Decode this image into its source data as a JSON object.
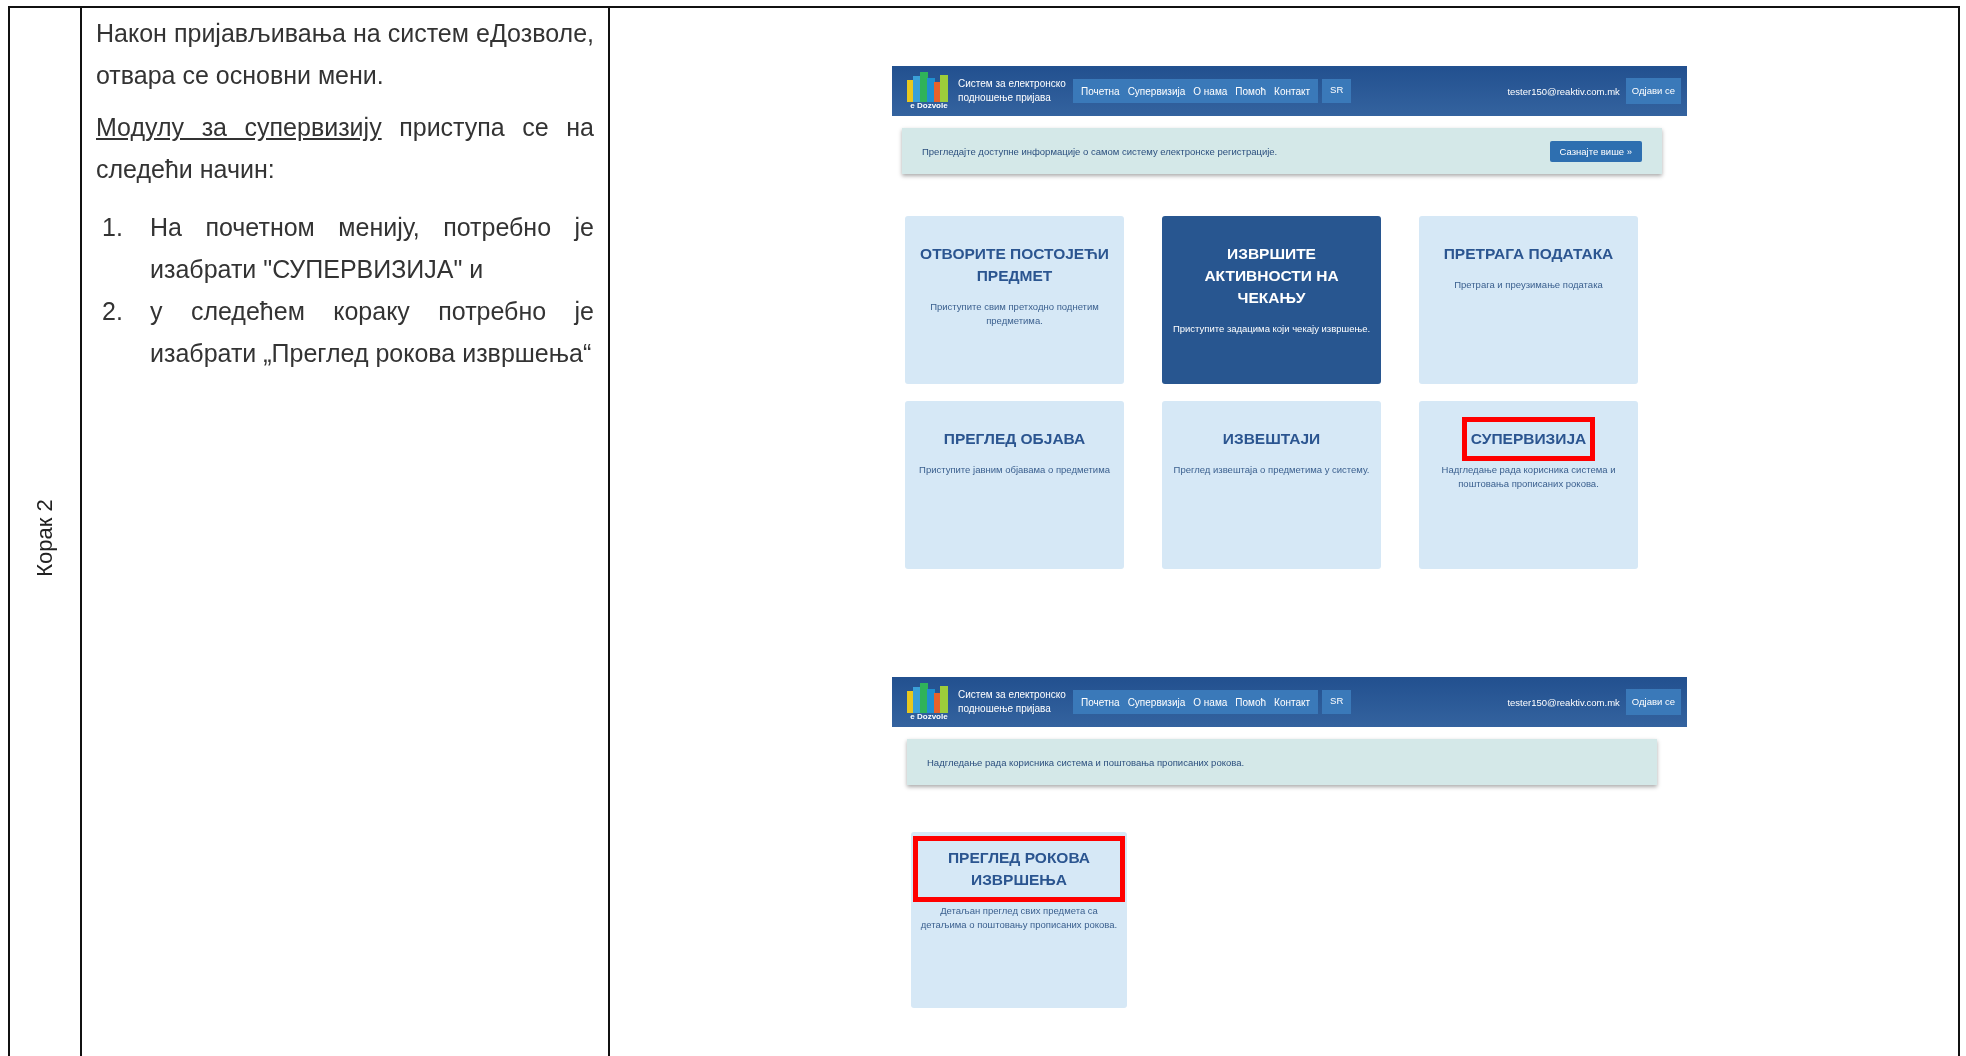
{
  "step_label": "Корак 2",
  "paragraphs": [
    {
      "text": "Након пријављивања на систем еДозволе, отвара се основни мени."
    },
    {
      "underlined": "Модулу за супервизију",
      "text": " приступа се на следећи начин:"
    }
  ],
  "steps": [
    {
      "number": "1.",
      "text": "На почетном менију, потребно је изабрати \"СУПЕРВИЗИЈА\" и"
    },
    {
      "number": "2.",
      "text": "у следећем кораку потребно је изабрати „Преглед рокова извршења“"
    }
  ],
  "screenshots": [
    {
      "logo_text": "e Dozvole",
      "app_title": "Систем за електронско подношење пријава",
      "nav": [
        "Почетна",
        "Супервизија",
        "О нама",
        "Помоћ",
        "Контакт"
      ],
      "language": "SR",
      "user": "tester150@reaktiv.com.mk",
      "logout": "Одјави се",
      "banner": {
        "text": "Прегледајте доступне информације о самом систему електронске регистрације.",
        "button": "Сазнајте више »"
      },
      "tiles": [
        {
          "title": "ОТВОРИТЕ ПОСТОЈЕЋИ ПРЕДМЕТ",
          "description": "Приступите свим претходно поднетим предметима.",
          "active": false,
          "highlighted": false
        },
        {
          "title": "ИЗВРШИТЕ АКТИВНОСТИ НА ЧЕКАЊУ",
          "description": "Приступите задацима који чекају извршење.",
          "active": true,
          "highlighted": false
        },
        {
          "title": "ПРЕТРАГА ПОДАТАКА",
          "description": "Претрага и преузимање података",
          "active": false,
          "highlighted": false
        },
        {
          "title": "ПРЕГЛЕД ОБЈАВА",
          "description": "Приступите јавним објавама о предметима",
          "active": false,
          "highlighted": false
        },
        {
          "title": "ИЗВЕШТАЈИ",
          "description": "Преглед извештаја о предметима у систему.",
          "active": false,
          "highlighted": false
        },
        {
          "title": "СУПЕРВИЗИЈА",
          "description": "Надгледање рада корисника система и поштовања прописаних рокова.",
          "active": false,
          "highlighted": true
        }
      ]
    },
    {
      "logo_text": "e Dozvole",
      "app_title": "Систем за електронско подношење пријава",
      "nav": [
        "Почетна",
        "Супервизија",
        "О нама",
        "Помоћ",
        "Контакт"
      ],
      "language": "SR",
      "user": "tester150@reaktiv.com.mk",
      "logout": "Одјави се",
      "banner": {
        "text": "Надгледање рада корисника система и поштовања прописаних рокова."
      },
      "tiles": [
        {
          "title": "ПРЕГЛЕД РОКОВА ИЗВРШЕЊА",
          "description": "Детаљан преглед свих предмета са детаљима о поштовању прописаних рокова.",
          "active": false,
          "highlighted": true
        }
      ]
    }
  ]
}
